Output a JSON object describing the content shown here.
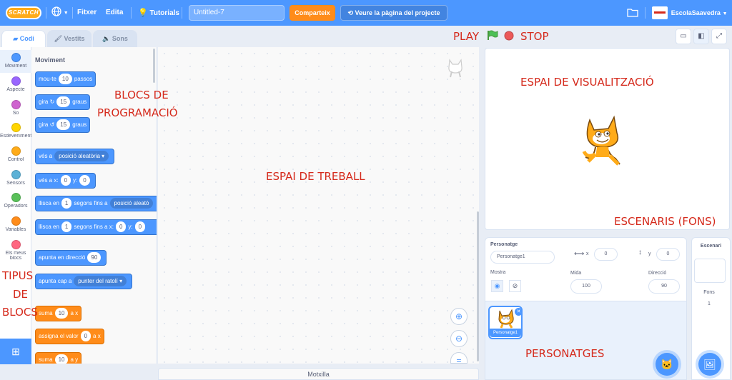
{
  "menubar": {
    "logo": "SCRATCH",
    "file": "Fitxer",
    "edit": "Edita",
    "tutorials": "Tutorials",
    "project_title": "Untitled-7",
    "share": "Comparteix",
    "see_project": "Veure la pàgina del projecte",
    "username": "EscolaSaavedra"
  },
  "tabs": {
    "code": "Codi",
    "costumes": "Vestits",
    "sounds": "Sons"
  },
  "categories": [
    {
      "label": "Moviment",
      "color": "#4c97ff"
    },
    {
      "label": "Aspecte",
      "color": "#9966ff"
    },
    {
      "label": "So",
      "color": "#cf63cf"
    },
    {
      "label": "Esdeveniments",
      "color": "#ffd500"
    },
    {
      "label": "Control",
      "color": "#ffab19"
    },
    {
      "label": "Sensors",
      "color": "#5cb1d6"
    },
    {
      "label": "Operadors",
      "color": "#59c059"
    },
    {
      "label": "Variables",
      "color": "#ff8c1a"
    },
    {
      "label": "Els meus",
      "label2": "blocs",
      "color": "#ff6680"
    }
  ],
  "palette": {
    "title": "Moviment",
    "move": {
      "a": "mou-te",
      "n": "10",
      "b": "passos"
    },
    "turn_right": {
      "a": "gira",
      "n": "15",
      "b": "graus"
    },
    "turn_left": {
      "a": "gira",
      "n": "15",
      "b": "graus"
    },
    "goto": {
      "a": "vés a",
      "drop": "posició aleatòria"
    },
    "goto_xy": {
      "a": "vés a x:",
      "x": "0",
      "b": "y:",
      "y": "0"
    },
    "glide": {
      "a": "llisca en",
      "n": "1",
      "b": "segons fins a",
      "drop": "posició aleatò"
    },
    "glide_xy": {
      "a": "llisca en",
      "n": "1",
      "b": "segons fins a x:",
      "x": "0",
      "c": "y:",
      "y": "0"
    },
    "point_dir": {
      "a": "apunta en direcció",
      "n": "90"
    },
    "point_towards": {
      "a": "apunta cap a",
      "drop": "punter del ratolí"
    },
    "var_change": {
      "a": "suma",
      "n": "10",
      "b": "a x"
    },
    "var_set": {
      "a": "assigna el valor",
      "n": "0",
      "b": "a x"
    },
    "var_change2": {
      "a": "suma",
      "n": "10",
      "b": "a y"
    }
  },
  "motxilla": "Motxilla",
  "sprite": {
    "label_sprite": "Personatge",
    "name": "Personatge1",
    "x_label": "x",
    "x": "0",
    "y_label": "y",
    "y": "0",
    "show_label": "Mostra",
    "size_label": "Mida",
    "size": "100",
    "direction_label": "Direcció",
    "direction": "90",
    "thumb_label": "Personatge1"
  },
  "stage_target": {
    "title": "Escenari",
    "backdrops_label": "Fons",
    "backdrops_count": "1"
  },
  "annotations": {
    "play_stop": "PLAY",
    "stop": "STOP",
    "blocks_1": "BLOCS DE",
    "blocks_2": "PROGRAMACIÓ",
    "workspace": "ESPAI DE TREBALL",
    "stage": "ESPAI DE VISUALITZACIÓ",
    "backdrops": "ESCENARIS (FONS)",
    "sprites": "PERSONATGES",
    "types_1": "TIPUS",
    "types_2": "DE",
    "types_3": "BLOCS"
  },
  "colors": {
    "accent": "#4c97ff",
    "annotation": "#d52a1c",
    "share": "#ff8c1a"
  }
}
